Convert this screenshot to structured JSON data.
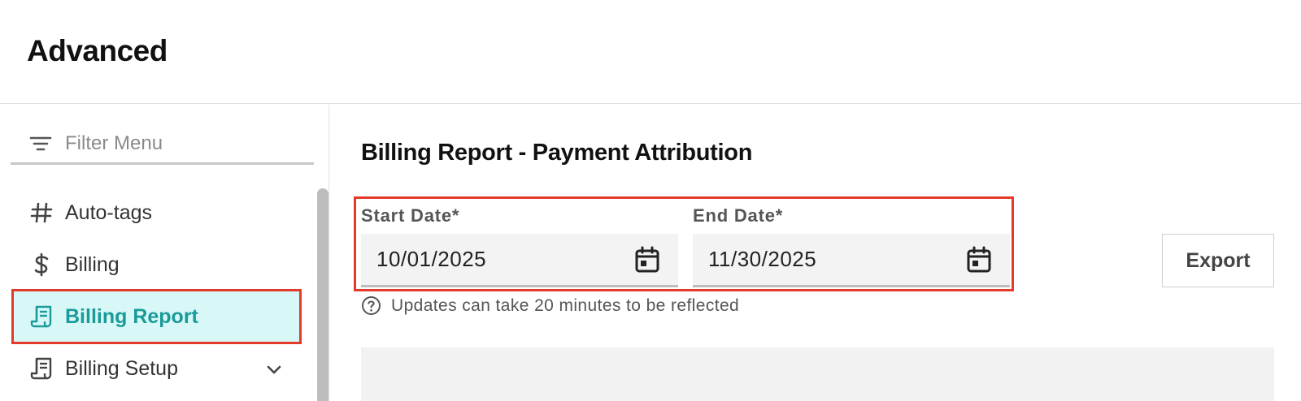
{
  "app": {
    "title": "Advanced"
  },
  "sidebar": {
    "filter_placeholder": "Filter Menu",
    "items": [
      {
        "label": "Auto-tags",
        "icon": "hash-icon"
      },
      {
        "label": "Billing",
        "icon": "dollar-icon"
      },
      {
        "label": "Billing Report",
        "icon": "receipt-icon",
        "active": true
      },
      {
        "label": "Billing Setup",
        "icon": "receipt-icon",
        "expandable": true
      }
    ]
  },
  "main": {
    "title": "Billing Report - Payment Attribution",
    "start_date": {
      "label": "Start Date*",
      "value": "10/01/2025"
    },
    "end_date": {
      "label": "End Date*",
      "value": "11/30/2025"
    },
    "export_label": "Export",
    "hint": "Updates can take 20 minutes to be reflected"
  },
  "colors": {
    "accent": "#1a9b99",
    "active_bg": "#d7f8f7",
    "highlight_outline": "#e33b2b"
  }
}
